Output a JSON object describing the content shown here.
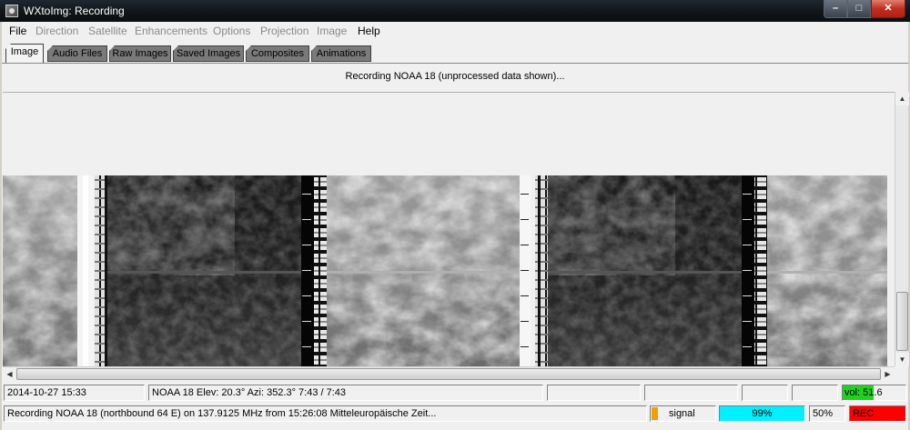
{
  "window": {
    "title": "WXtoImg: Recording",
    "controls": {
      "minimize": "–",
      "maximize": "□",
      "close": "✕"
    }
  },
  "menu": [
    {
      "label": "File",
      "enabled": true
    },
    {
      "label": "Direction",
      "enabled": false
    },
    {
      "label": "Satellite",
      "enabled": false
    },
    {
      "label": "Enhancements",
      "enabled": false
    },
    {
      "label": "Options",
      "enabled": false
    },
    {
      "label": "Projection",
      "enabled": false
    },
    {
      "label": "Image",
      "enabled": false
    },
    {
      "label": "Help",
      "enabled": true
    }
  ],
  "tabs": [
    {
      "label": "Image",
      "active": true
    },
    {
      "label": "Audio Files",
      "active": false
    },
    {
      "label": "Raw Images",
      "active": false
    },
    {
      "label": "Saved Images",
      "active": false
    },
    {
      "label": "Composites",
      "active": false
    },
    {
      "label": "Animations",
      "active": false
    }
  ],
  "image_panel": {
    "header": "Recording NOAA 18 (unprocessed data shown)..."
  },
  "status": {
    "datetime": "2014-10-27  15:33",
    "pass_info": "NOAA 18   Elev: 20.3°   Azi: 352.3°   7:43 / 7:43",
    "volume": "vol: 51.6",
    "recording_message": "Recording NOAA 18 (northbound 64 E) on 137.9125 MHz from 15:26:08 Mitteleuropäische Zeit...",
    "signal_label": "signal",
    "signal_level": 0.1,
    "progress": "99%",
    "zoom": "50%",
    "rec_label": "REC"
  },
  "colors": {
    "volume_bg": "#1ed21e",
    "signal_indicator": "#f2a000",
    "progress_bg": "#00f0ff",
    "rec_bg": "#ff0000"
  }
}
